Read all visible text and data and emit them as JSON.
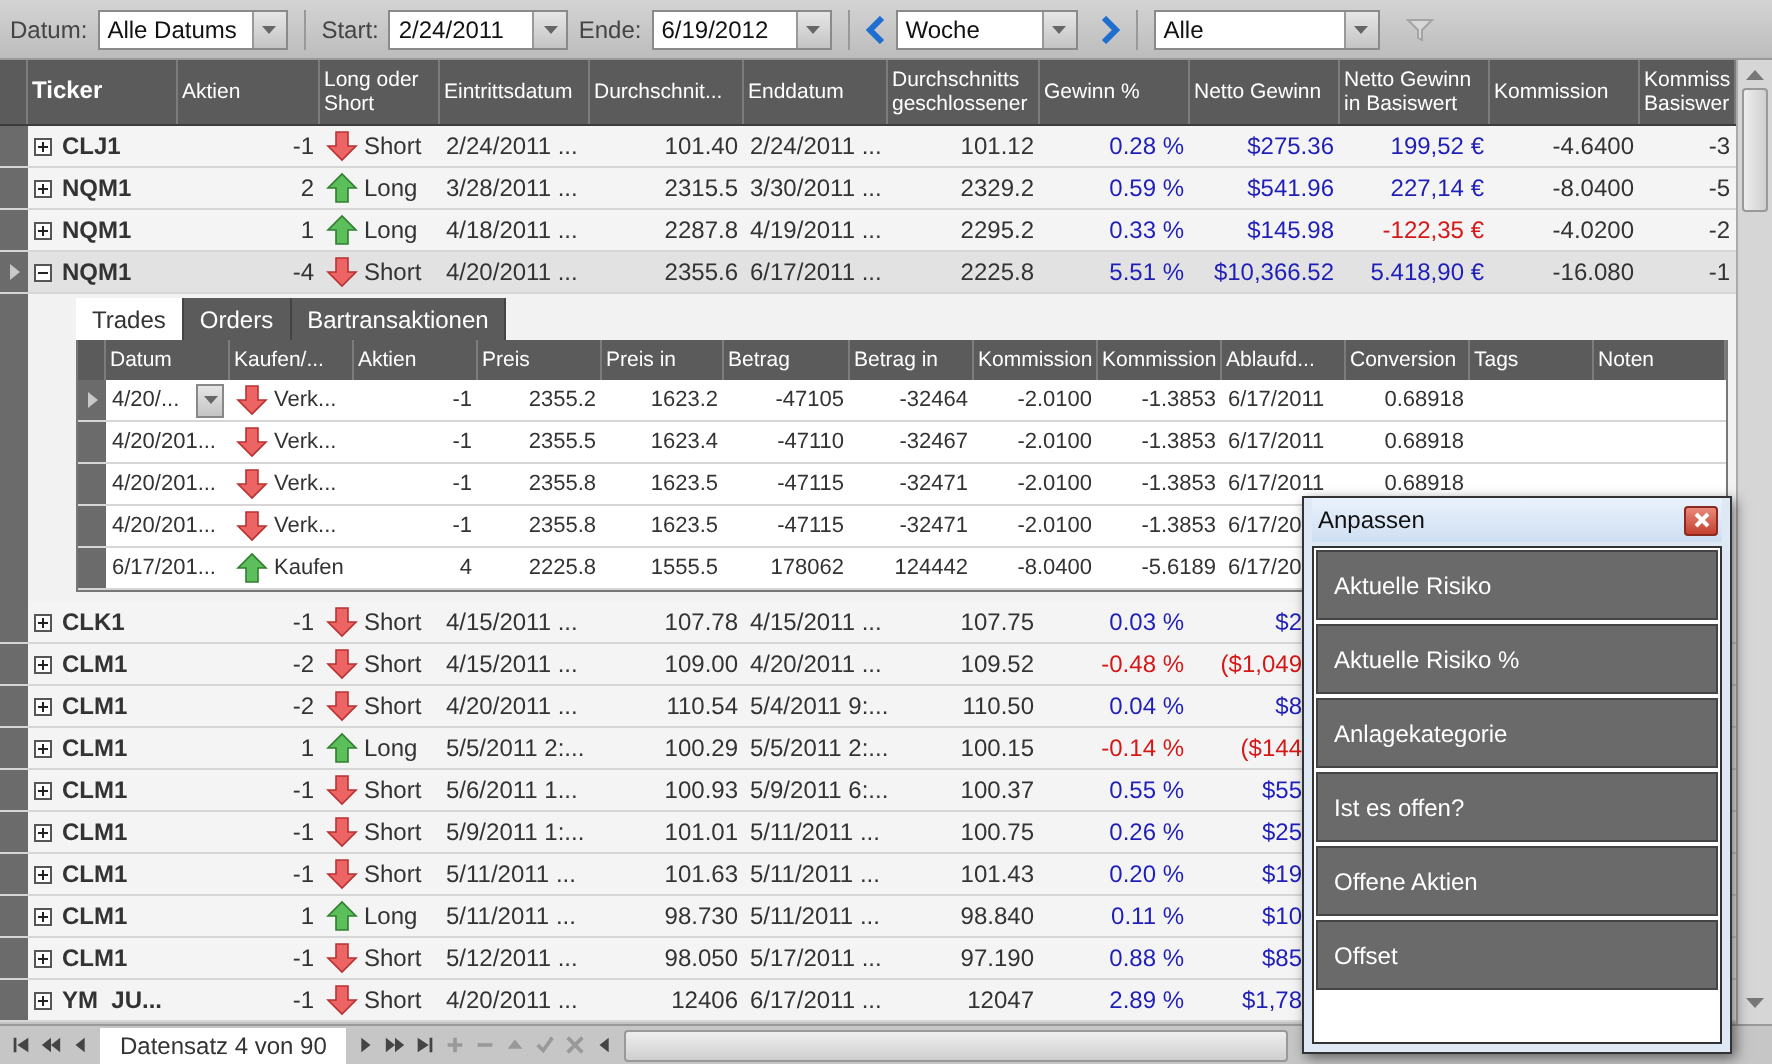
{
  "toolbar": {
    "datum_label": "Datum:",
    "datum_value": "Alle Datums",
    "start_label": "Start:",
    "start_value": "2/24/2011",
    "ende_label": "Ende:",
    "ende_value": "6/19/2012",
    "period_value": "Woche",
    "filter_value": "Alle"
  },
  "columns": [
    "Ticker",
    "Aktien",
    "Long oder Short",
    "Eintrittsdatum",
    "Durchschnit...",
    "Enddatum",
    "Durchschnitts geschlossener",
    "Gewinn %",
    "Netto Gewinn",
    "Netto Gewinn in Basiswert",
    "Kommission",
    "Kommiss Basiswer"
  ],
  "rows": [
    {
      "ticker": "CLJ1",
      "expanded": false,
      "selected": false,
      "aktien": "-1",
      "kind": "short",
      "direction_label": "Short",
      "eintritt": "2/24/2011 ...",
      "durchschnitt": "101.40",
      "enddatum": "2/24/2011 ...",
      "geschlossen": "101.12",
      "gewinn": "0.28 %",
      "gewinn_negative": false,
      "netto": "$275.36",
      "netto_basis": "199,52 €",
      "basis_negative": false,
      "kommission": "-4.6400",
      "kommission_basis": "-3"
    },
    {
      "ticker": "NQM1",
      "expanded": false,
      "selected": false,
      "aktien": "2",
      "kind": "long",
      "direction_label": "Long",
      "eintritt": "3/28/2011 ...",
      "durchschnitt": "2315.5",
      "enddatum": "3/30/2011 ...",
      "geschlossen": "2329.2",
      "gewinn": "0.59 %",
      "gewinn_negative": false,
      "netto": "$541.96",
      "netto_basis": "227,14 €",
      "basis_negative": false,
      "kommission": "-8.0400",
      "kommission_basis": "-5"
    },
    {
      "ticker": "NQM1",
      "expanded": false,
      "selected": false,
      "aktien": "1",
      "kind": "long",
      "direction_label": "Long",
      "eintritt": "4/18/2011 ...",
      "durchschnitt": "2287.8",
      "enddatum": "4/19/2011 ...",
      "geschlossen": "2295.2",
      "gewinn": "0.33 %",
      "gewinn_negative": false,
      "netto": "$145.98",
      "netto_basis": "-122,35 €",
      "basis_negative": true,
      "kommission": "-4.0200",
      "kommission_basis": "-2"
    },
    {
      "ticker": "NQM1",
      "expanded": true,
      "selected": true,
      "aktien": "-4",
      "kind": "short",
      "direction_label": "Short",
      "eintritt": "4/20/2011 ...",
      "durchschnitt": "2355.6",
      "enddatum": "6/17/2011 ...",
      "geschlossen": "2225.8",
      "gewinn": "5.51 %",
      "gewinn_negative": false,
      "netto": "$10,366.52",
      "netto_basis": "5.418,90 €",
      "basis_negative": false,
      "kommission": "-16.080",
      "kommission_basis": "-1"
    }
  ],
  "detail": {
    "tabs": [
      {
        "label": "Trades",
        "selected": true
      },
      {
        "label": "Orders",
        "selected": false
      },
      {
        "label": "Bartransaktionen",
        "selected": false
      }
    ],
    "columns": [
      "Datum",
      "Kaufen/...",
      "Aktien",
      "Preis",
      "Preis in",
      "Betrag",
      "Betrag in",
      "Kommission",
      "Kommission",
      "Ablaufd...",
      "Conversion",
      "Tags",
      "Noten"
    ],
    "rows": [
      {
        "datum": "4/20/...",
        "selected": true,
        "kind": "short",
        "action": "Verk...",
        "aktien": "-1",
        "preis": "2355.2",
        "preis_in": "1623.2",
        "betrag": "-47105",
        "betrag_in": "-32464",
        "kommission": "-2.0100",
        "kommission_2": "-1.3853",
        "ablauf": "6/17/2011",
        "conversion": "0.68918"
      },
      {
        "datum": "4/20/201...",
        "selected": false,
        "kind": "short",
        "action": "Verk...",
        "aktien": "-1",
        "preis": "2355.5",
        "preis_in": "1623.4",
        "betrag": "-47110",
        "betrag_in": "-32467",
        "kommission": "-2.0100",
        "kommission_2": "-1.3853",
        "ablauf": "6/17/2011",
        "conversion": "0.68918"
      },
      {
        "datum": "4/20/201...",
        "selected": false,
        "kind": "short",
        "action": "Verk...",
        "aktien": "-1",
        "preis": "2355.8",
        "preis_in": "1623.5",
        "betrag": "-47115",
        "betrag_in": "-32471",
        "kommission": "-2.0100",
        "kommission_2": "-1.3853",
        "ablauf": "6/17/2011",
        "conversion": "0.68918"
      },
      {
        "datum": "4/20/201...",
        "selected": false,
        "kind": "short",
        "action": "Verk...",
        "aktien": "-1",
        "preis": "2355.8",
        "preis_in": "1623.5",
        "betrag": "-47115",
        "betrag_in": "-32471",
        "kommission": "-2.0100",
        "kommission_2": "-1.3853",
        "ablauf": "6/17/20"
      },
      {
        "datum": "6/17/201...",
        "selected": false,
        "kind": "long",
        "action": "Kaufen",
        "aktien": "4",
        "preis": "2225.8",
        "preis_in": "1555.5",
        "betrag": "178062",
        "betrag_in": "124442",
        "kommission": "-8.0400",
        "kommission_2": "-5.6189",
        "ablauf": "6/17/20"
      }
    ]
  },
  "rows_after_detail": [
    {
      "ticker": "CLK1",
      "expanded": false,
      "selected": false,
      "aktien": "-1",
      "kind": "short",
      "direction_label": "Short",
      "eintritt": "4/15/2011 ...",
      "durchschnitt": "107.78",
      "enddatum": "4/15/2011 ...",
      "geschlossen": "107.75",
      "gewinn": "0.03 %",
      "gewinn_negative": false,
      "netto": "$2"
    },
    {
      "ticker": "CLM1",
      "expanded": false,
      "selected": false,
      "aktien": "-2",
      "kind": "short",
      "direction_label": "Short",
      "eintritt": "4/15/2011 ...",
      "durchschnitt": "109.00",
      "enddatum": "4/20/2011 ...",
      "geschlossen": "109.52",
      "gewinn": "-0.48 %",
      "gewinn_negative": true,
      "netto": "($1,049"
    },
    {
      "ticker": "CLM1",
      "expanded": false,
      "selected": false,
      "aktien": "-2",
      "kind": "short",
      "direction_label": "Short",
      "eintritt": "4/20/2011 ...",
      "durchschnitt": "110.54",
      "enddatum": "5/4/2011 9:...",
      "geschlossen": "110.50",
      "gewinn": "0.04 %",
      "gewinn_negative": false,
      "netto": "$8"
    },
    {
      "ticker": "CLM1",
      "expanded": false,
      "selected": false,
      "aktien": "1",
      "kind": "long",
      "direction_label": "Long",
      "eintritt": "5/5/2011 2:...",
      "durchschnitt": "100.29",
      "enddatum": "5/5/2011 2:...",
      "geschlossen": "100.15",
      "gewinn": "-0.14 %",
      "gewinn_negative": true,
      "netto": "($144"
    },
    {
      "ticker": "CLM1",
      "expanded": false,
      "selected": false,
      "aktien": "-1",
      "kind": "short",
      "direction_label": "Short",
      "eintritt": "5/6/2011 1...",
      "durchschnitt": "100.93",
      "enddatum": "5/9/2011 6:...",
      "geschlossen": "100.37",
      "gewinn": "0.55 %",
      "gewinn_negative": false,
      "netto": "$55"
    },
    {
      "ticker": "CLM1",
      "expanded": false,
      "selected": false,
      "aktien": "-1",
      "kind": "short",
      "direction_label": "Short",
      "eintritt": "5/9/2011 1:...",
      "durchschnitt": "101.01",
      "enddatum": "5/11/2011 ...",
      "geschlossen": "100.75",
      "gewinn": "0.26 %",
      "gewinn_negative": false,
      "netto": "$25"
    },
    {
      "ticker": "CLM1",
      "expanded": false,
      "selected": false,
      "aktien": "-1",
      "kind": "short",
      "direction_label": "Short",
      "eintritt": "5/11/2011 ...",
      "durchschnitt": "101.63",
      "enddatum": "5/11/2011 ...",
      "geschlossen": "101.43",
      "gewinn": "0.20 %",
      "gewinn_negative": false,
      "netto": "$19"
    },
    {
      "ticker": "CLM1",
      "expanded": false,
      "selected": false,
      "aktien": "1",
      "kind": "long",
      "direction_label": "Long",
      "eintritt": "5/11/2011 ...",
      "durchschnitt": "98.730",
      "enddatum": "5/11/2011 ...",
      "geschlossen": "98.840",
      "gewinn": "0.11 %",
      "gewinn_negative": false,
      "netto": "$10"
    },
    {
      "ticker": "CLM1",
      "expanded": false,
      "selected": false,
      "aktien": "-1",
      "kind": "short",
      "direction_label": "Short",
      "eintritt": "5/12/2011 ...",
      "durchschnitt": "98.050",
      "enddatum": "5/17/2011 ...",
      "geschlossen": "97.190",
      "gewinn": "0.88 %",
      "gewinn_negative": false,
      "netto": "$85"
    },
    {
      "ticker": "YM  JU...",
      "expanded": false,
      "selected": false,
      "aktien": "-1",
      "kind": "short",
      "direction_label": "Short",
      "eintritt": "4/20/2011 ...",
      "durchschnitt": "12406",
      "enddatum": "6/17/2011 ...",
      "geschlossen": "12047",
      "gewinn": "2.89 %",
      "gewinn_negative": false,
      "netto": "$1,78"
    }
  ],
  "navigator": {
    "record": "Datensatz 4 von 90"
  },
  "dialog": {
    "title": "Anpassen",
    "items": [
      "Aktuelle Risiko",
      "Aktuelle Risiko %",
      "Anlagekategorie",
      "Ist es offen?",
      "Offene Aktien",
      "Offset"
    ]
  }
}
